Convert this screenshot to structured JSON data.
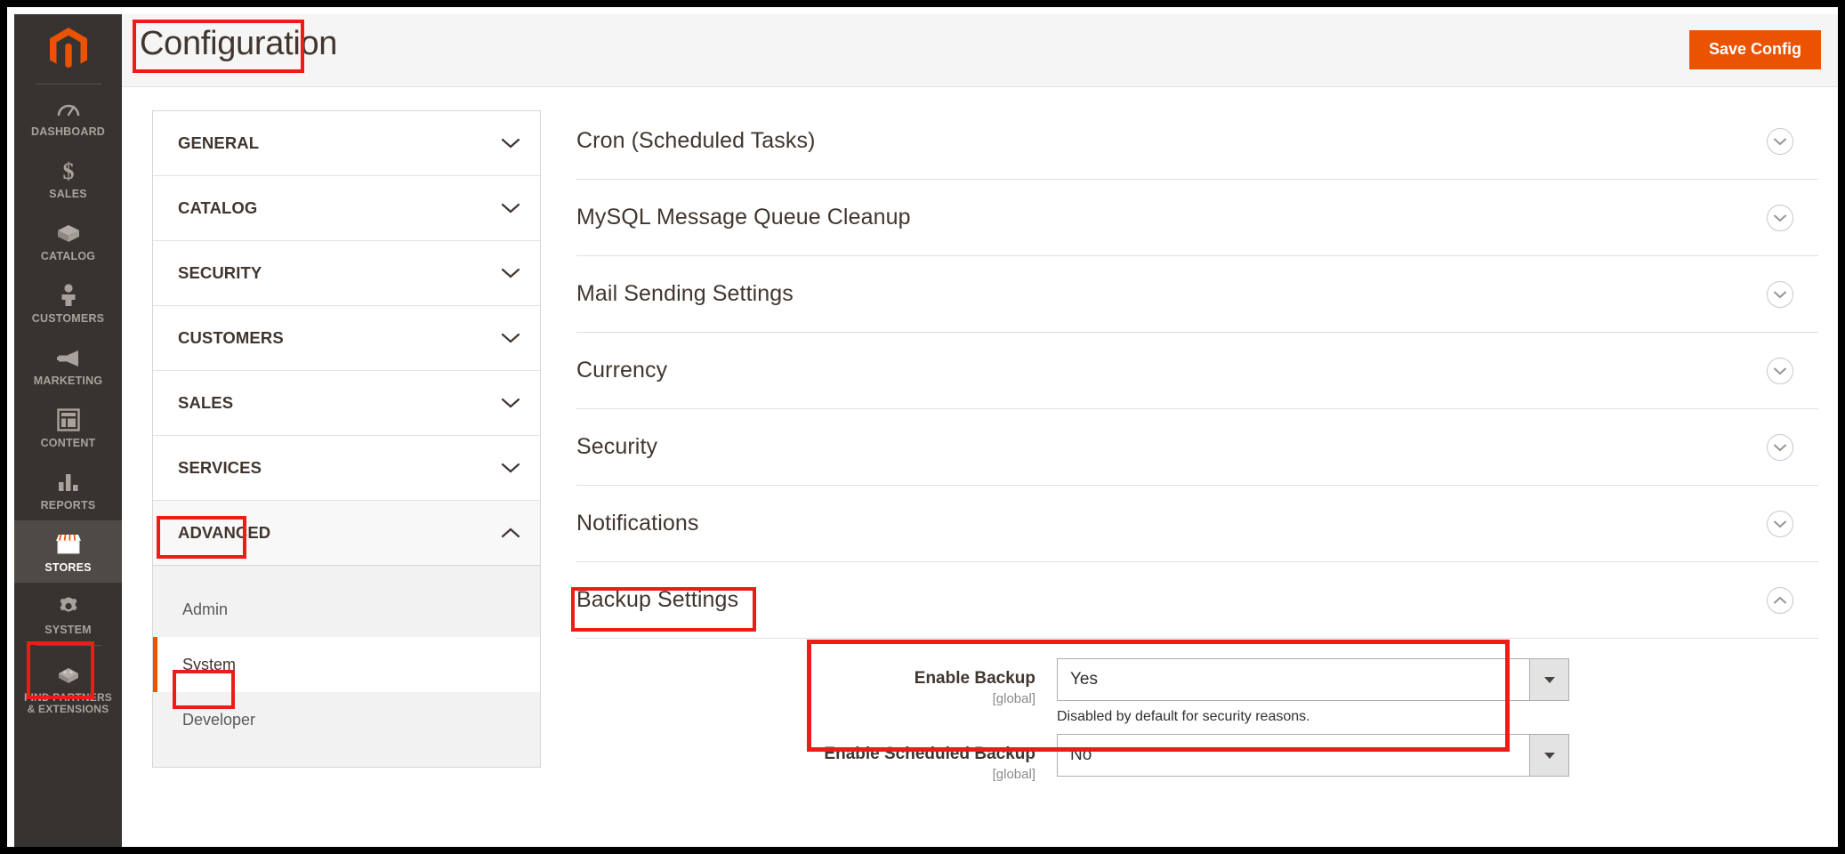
{
  "header": {
    "title": "Configuration",
    "save_label": "Save Config",
    "accent_color": "#eb5202",
    "annotation_color": "#ee1c17"
  },
  "adminbar": {
    "logo": "magento-logo",
    "items": [
      {
        "label": "DASHBOARD",
        "icon": "dashboard-icon",
        "active": false
      },
      {
        "label": "SALES",
        "icon": "sales-dollar-icon",
        "active": false
      },
      {
        "label": "CATALOG",
        "icon": "catalog-box-icon",
        "active": false
      },
      {
        "label": "CUSTOMERS",
        "icon": "customers-person-icon",
        "active": false
      },
      {
        "label": "MARKETING",
        "icon": "marketing-megaphone-icon",
        "active": false
      },
      {
        "label": "CONTENT",
        "icon": "content-layout-icon",
        "active": false
      },
      {
        "label": "REPORTS",
        "icon": "reports-bar-chart-icon",
        "active": false
      },
      {
        "label": "STORES",
        "icon": "stores-shop-icon",
        "active": true
      },
      {
        "label": "SYSTEM",
        "icon": "system-gear-icon",
        "active": false
      }
    ],
    "partners": {
      "label": "FIND PARTNERS\n& EXTENSIONS",
      "icon": "partners-blocks-icon"
    }
  },
  "config_nav": {
    "sections": [
      {
        "label": "GENERAL",
        "expanded": false
      },
      {
        "label": "CATALOG",
        "expanded": false
      },
      {
        "label": "SECURITY",
        "expanded": false
      },
      {
        "label": "CUSTOMERS",
        "expanded": false
      },
      {
        "label": "SALES",
        "expanded": false
      },
      {
        "label": "SERVICES",
        "expanded": false
      },
      {
        "label": "ADVANCED",
        "expanded": true
      }
    ],
    "advanced_items": [
      {
        "label": "Admin",
        "active": false
      },
      {
        "label": "System",
        "active": true
      },
      {
        "label": "Developer",
        "active": false
      }
    ]
  },
  "content": {
    "sections": [
      {
        "label": "Cron (Scheduled Tasks)",
        "expanded": false
      },
      {
        "label": "MySQL Message Queue Cleanup",
        "expanded": false
      },
      {
        "label": "Mail Sending Settings",
        "expanded": false
      },
      {
        "label": "Currency",
        "expanded": false
      },
      {
        "label": "Security",
        "expanded": false
      },
      {
        "label": "Notifications",
        "expanded": false
      },
      {
        "label": "Backup Settings",
        "expanded": true
      }
    ],
    "backup_fields": [
      {
        "label": "Enable Backup",
        "scope": "[global]",
        "value": "Yes",
        "hint": "Disabled by default for security reasons."
      },
      {
        "label": "Enable Scheduled Backup",
        "scope": "[global]",
        "value": "No",
        "hint": ""
      }
    ]
  }
}
